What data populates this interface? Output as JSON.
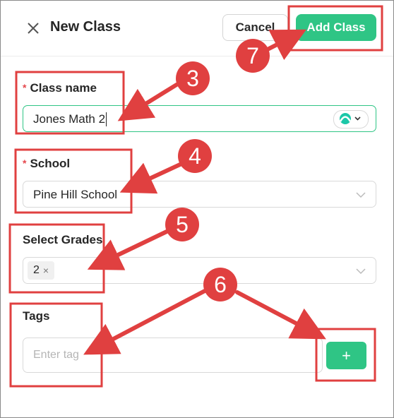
{
  "header": {
    "title": "New Class",
    "cancel_label": "Cancel",
    "add_label": "Add Class"
  },
  "form": {
    "class_name": {
      "label": "Class name",
      "required_mark": "*",
      "value": "Jones Math 2"
    },
    "school": {
      "label": "School",
      "required_mark": "*",
      "value": "Pine Hill School"
    },
    "grades": {
      "label": "Select Grades",
      "selected": "2",
      "remove_glyph": "×"
    },
    "tags": {
      "label": "Tags",
      "placeholder": "Enter tag",
      "add_glyph": "+"
    }
  },
  "annotations": {
    "step3": "3",
    "step4": "4",
    "step5": "5",
    "step6": "6",
    "step7": "7"
  },
  "colors": {
    "accent": "#2fc585",
    "annotation": "#e04040",
    "required": "#e5484d"
  }
}
